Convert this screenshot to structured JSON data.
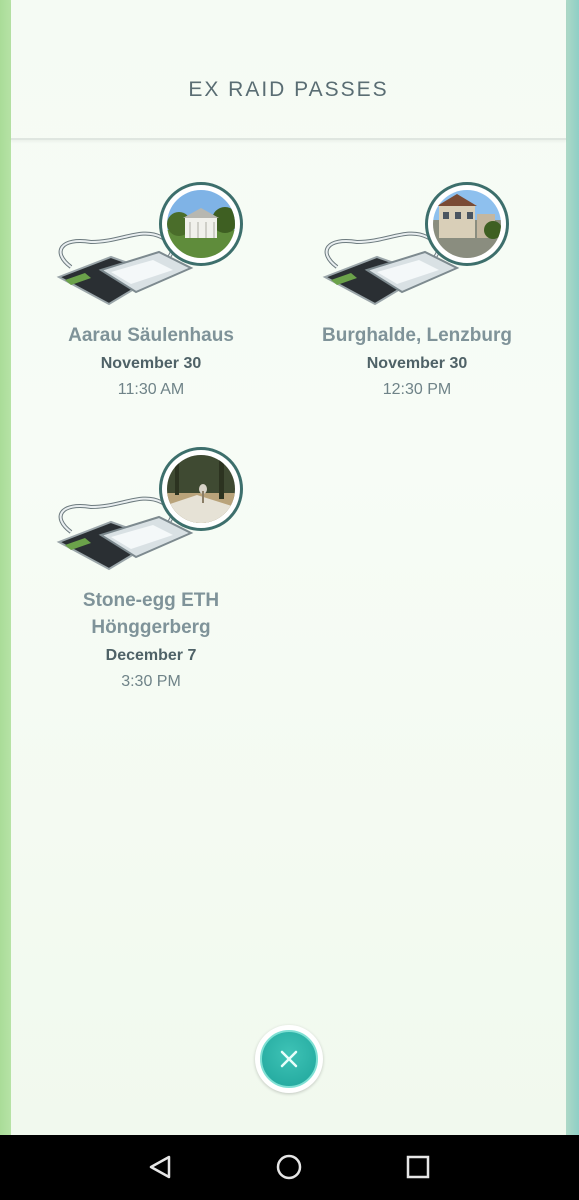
{
  "header": {
    "title": "EX RAID PASSES"
  },
  "passes": [
    {
      "location": "Aarau Säulenhaus",
      "date": "November 30",
      "time": "11:30 AM"
    },
    {
      "location": "Burghalde, Lenzburg",
      "date": "November 30",
      "time": "12:30 PM"
    },
    {
      "location": "Stone-egg ETH Hönggerberg",
      "date": "December 7",
      "time": "3:30 PM"
    }
  ],
  "colors": {
    "accent": "#1fa59b",
    "title_text": "#5a6d73",
    "thumb_border": "#3d6f6c"
  },
  "icons": {
    "close": "close-icon",
    "back": "back-icon",
    "home": "home-icon",
    "recents": "recents-icon"
  }
}
